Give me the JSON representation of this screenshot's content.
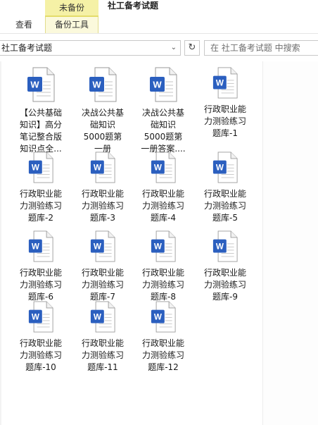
{
  "ribbon": {
    "context_group": "未备份",
    "window_title": "社工备考试题",
    "tabs": {
      "view": "查看",
      "backup_tools": "备份工具"
    }
  },
  "address_bar": {
    "path": "社工备考试题",
    "chevron_icon": "chevron-down-icon",
    "refresh_icon": "refresh-icon",
    "search_placeholder": "在 社工备考试题 中搜索"
  },
  "colors": {
    "word_blue": "#2b5fbf",
    "ctx_yellow": "#f5f1a6"
  },
  "files": [
    {
      "lines": [
        "【公共基础",
        "知识】高分",
        "笔记整合版",
        "知识点全..."
      ],
      "icon": "word-doc-icon"
    },
    {
      "lines": [
        "决战公共基",
        "础知识",
        "5000题第",
        "一册"
      ],
      "icon": "word-doc-icon"
    },
    {
      "lines": [
        "决战公共基",
        "础知识",
        "5000题第",
        "一册答案...."
      ],
      "icon": "word-doc-icon"
    },
    {
      "lines": [
        "行政职业能",
        "力测验练习",
        "题库-1"
      ],
      "icon": "word-doc-icon"
    },
    {
      "lines": [
        "行政职业能",
        "力测验练习",
        "题库-2"
      ],
      "icon": "word-doc-icon"
    },
    {
      "lines": [
        "行政职业能",
        "力测验练习",
        "题库-3"
      ],
      "icon": "word-doc-icon"
    },
    {
      "lines": [
        "行政职业能",
        "力测验练习",
        "题库-4"
      ],
      "icon": "word-doc-icon"
    },
    {
      "lines": [
        "行政职业能",
        "力测验练习",
        "题库-5"
      ],
      "icon": "word-doc-icon"
    },
    {
      "lines": [
        "行政职业能",
        "力测验练习",
        "题库-6"
      ],
      "icon": "word-doc-icon"
    },
    {
      "lines": [
        "行政职业能",
        "力测验练习",
        "题库-7"
      ],
      "icon": "word-doc-icon"
    },
    {
      "lines": [
        "行政职业能",
        "力测验练习",
        "题库-8"
      ],
      "icon": "word-doc-icon"
    },
    {
      "lines": [
        "行政职业能",
        "力测验练习",
        "题库-9"
      ],
      "icon": "word-doc-icon"
    },
    {
      "lines": [
        "行政职业能",
        "力测验练习",
        "题库-10"
      ],
      "icon": "word-doc-icon"
    },
    {
      "lines": [
        "行政职业能",
        "力测验练习",
        "题库-11"
      ],
      "icon": "word-doc-icon"
    },
    {
      "lines": [
        "行政职业能",
        "力测验练习",
        "题库-12"
      ],
      "icon": "word-doc-icon"
    }
  ]
}
